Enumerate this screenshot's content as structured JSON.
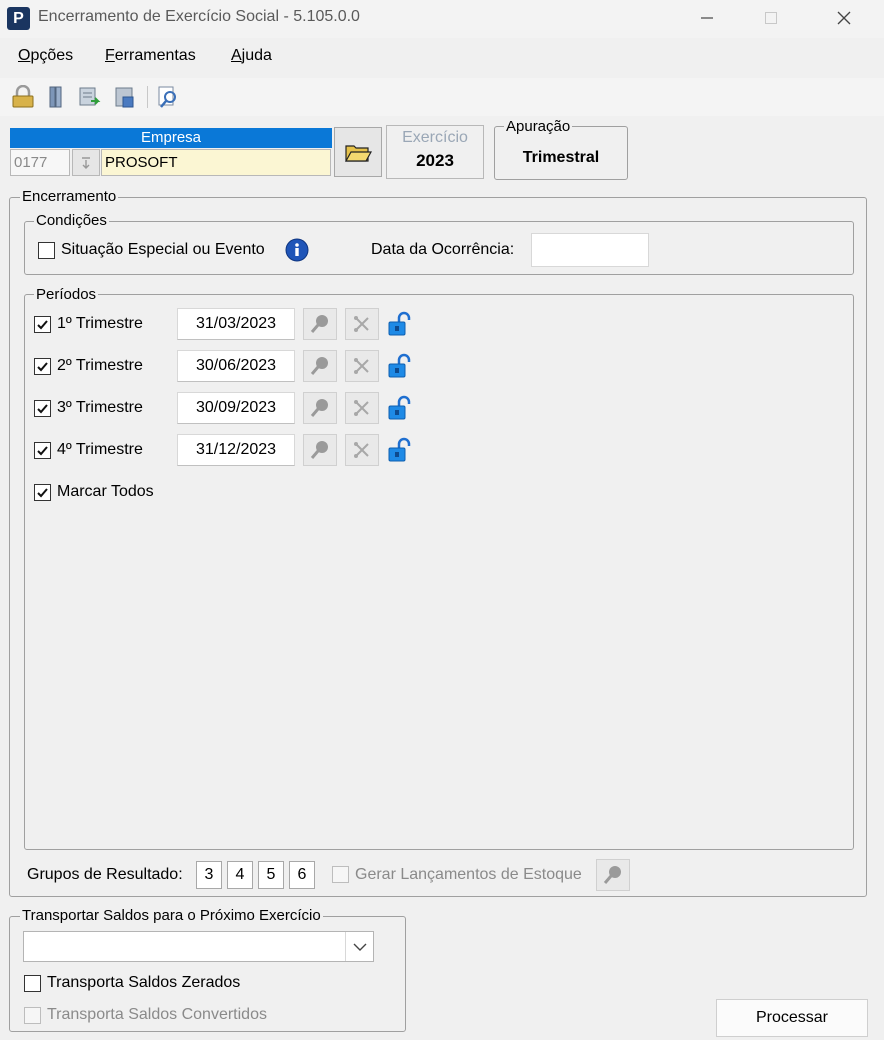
{
  "window": {
    "app_icon_letter": "P",
    "title": "Encerramento de Exercício Social - 5.105.0.0"
  },
  "menu": {
    "items": [
      {
        "accel": "O",
        "rest": "pções"
      },
      {
        "accel": "F",
        "rest": "erramentas"
      },
      {
        "accel": "A",
        "rest": "juda"
      }
    ]
  },
  "toolbar": {
    "icons": [
      "lock-icon",
      "binder-icon",
      "export-icon",
      "save-icon",
      "preview-icon"
    ]
  },
  "empresa": {
    "header": "Empresa",
    "code": "0177",
    "name": "PROSOFT"
  },
  "exercicio": {
    "label": "Exercício",
    "value": "2023"
  },
  "apuracao": {
    "label": "Apuração",
    "value": "Trimestral"
  },
  "encerramento": {
    "legend": "Encerramento",
    "condicoes": {
      "legend": "Condições",
      "situacao_label": "Situação Especial ou Evento",
      "situacao_checked": false,
      "data_label": "Data da Ocorrência:",
      "data_value": ""
    },
    "periodos": {
      "legend": "Períodos",
      "rows": [
        {
          "label": "1º Trimestre",
          "date": "31/03/2023",
          "checked": true
        },
        {
          "label": "2º Trimestre",
          "date": "30/06/2023",
          "checked": true
        },
        {
          "label": "3º Trimestre",
          "date": "30/09/2023",
          "checked": true
        },
        {
          "label": "4º Trimestre",
          "date": "31/12/2023",
          "checked": true
        }
      ],
      "marcar_todos": "Marcar Todos",
      "marcar_todos_checked": true
    },
    "grupos_label": "Grupos de Resultado:",
    "grupos": [
      "3",
      "4",
      "5",
      "6"
    ],
    "gerar_label": "Gerar Lançamentos de Estoque"
  },
  "transportar": {
    "legend": "Transportar Saldos para o Próximo Exercício",
    "select_value": "",
    "zerados_label": "Transporta Saldos Zerados",
    "convertidos_label": "Transporta Saldos Convertidos"
  },
  "processar_label": "Processar",
  "colors": {
    "accent": "#0a78d7",
    "name_field_bg": "#fbf6d3",
    "app_icon": "#1a3560"
  }
}
